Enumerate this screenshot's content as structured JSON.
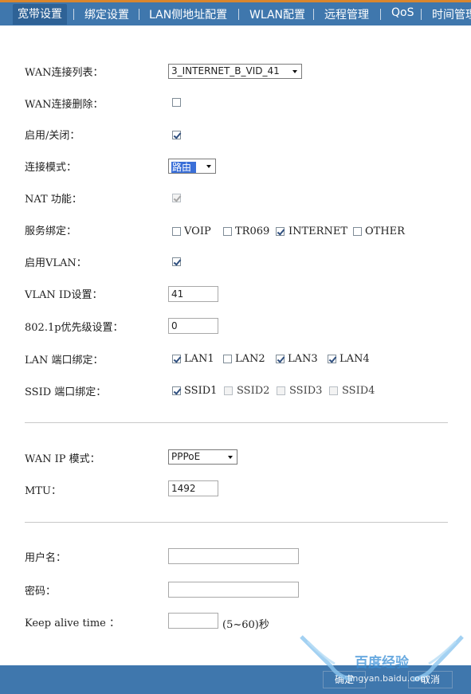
{
  "tabs": [
    "宽带设置",
    "绑定设置",
    "LAN侧地址配置",
    "WLAN配置",
    "远程管理",
    "QoS",
    "时间管理"
  ],
  "form": {
    "wan_list": {
      "label": "WAN连接列表：",
      "value": "3_INTERNET_B_VID_41"
    },
    "wan_delete": {
      "label": "WAN连接删除：",
      "checked": false
    },
    "enable": {
      "label": "启用/关闭：",
      "checked": true
    },
    "conn_mode": {
      "label": "连接模式：",
      "value": "路由"
    },
    "nat": {
      "label": "NAT 功能：",
      "checked": true,
      "disabled": true
    },
    "service_bind": {
      "label": "服务绑定：",
      "options": [
        {
          "name": "VOIP",
          "checked": false
        },
        {
          "name": "TR069",
          "checked": false
        },
        {
          "name": "INTERNET",
          "checked": true
        },
        {
          "name": "OTHER",
          "checked": false
        }
      ]
    },
    "enable_vlan": {
      "label": "启用VLAN：",
      "checked": true
    },
    "vlan_id": {
      "label": "VLAN ID设置：",
      "value": "41"
    },
    "priority": {
      "label": "802.1p优先级设置：",
      "value": "0"
    },
    "lan_bind": {
      "label": "LAN 端口绑定：",
      "options": [
        {
          "name": "LAN1",
          "checked": true
        },
        {
          "name": "LAN2",
          "checked": false
        },
        {
          "name": "LAN3",
          "checked": true
        },
        {
          "name": "LAN4",
          "checked": true
        }
      ]
    },
    "ssid_bind": {
      "label": "SSID 端口绑定：",
      "options": [
        {
          "name": "SSID1",
          "checked": true
        },
        {
          "name": "SSID2",
          "checked": false
        },
        {
          "name": "SSID3",
          "checked": false
        },
        {
          "name": "SSID4",
          "checked": false
        }
      ]
    },
    "wan_ip_mode": {
      "label": "WAN IP 模式：",
      "value": "PPPoE"
    },
    "mtu": {
      "label": "MTU：",
      "value": "1492"
    },
    "username": {
      "label": "用户名：",
      "value": ""
    },
    "password": {
      "label": "密码：",
      "value": ""
    },
    "keepalive": {
      "label": "Keep alive time ：",
      "value": "",
      "hint": "(5~60)秒"
    }
  },
  "buttons": {
    "ok": "确定",
    "cancel": "取消"
  },
  "watermark": {
    "text1": "百度经验",
    "text2": "jingyan.baidu.com"
  },
  "colors": {
    "tabbar": "#3f77ad",
    "accent": "#d9862e",
    "highlight": "#3a6fd8"
  }
}
